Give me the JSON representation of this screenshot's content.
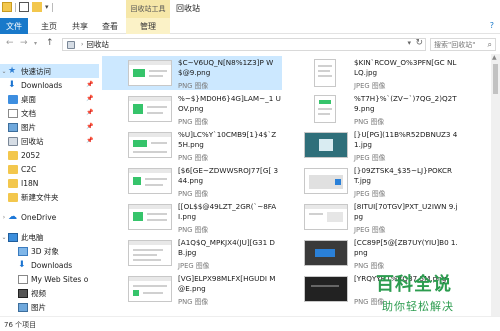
{
  "titlebar": {
    "context_tab": "回收站工具",
    "title": "回收站"
  },
  "ribbon": {
    "tabs": [
      "文件",
      "主页",
      "共享",
      "查看",
      "管理"
    ]
  },
  "address": {
    "location": "回收站",
    "search_placeholder": "搜索\"回收站\""
  },
  "sidebar": {
    "items": [
      {
        "label": "快速访问",
        "icon": "star-icon"
      },
      {
        "label": "Downloads",
        "icon": "download-icon",
        "pinned": true
      },
      {
        "label": "桌面",
        "icon": "desktop-folder-icon",
        "pinned": true
      },
      {
        "label": "文档",
        "icon": "documents-folder-icon",
        "pinned": true
      },
      {
        "label": "图片",
        "icon": "pictures-folder-icon",
        "pinned": true
      },
      {
        "label": "回收站",
        "icon": "recycle-bin-icon",
        "pinned": true
      },
      {
        "label": "2052",
        "icon": "folder-icon"
      },
      {
        "label": "C2C",
        "icon": "folder-icon"
      },
      {
        "label": "I18N",
        "icon": "folder-icon"
      },
      {
        "label": "新建文件夹",
        "icon": "folder-icon"
      },
      {
        "label": "OneDrive",
        "icon": "cloud-icon"
      },
      {
        "label": "此电脑",
        "icon": "computer-icon"
      },
      {
        "label": "3D 对象",
        "icon": "3d-objects-icon"
      },
      {
        "label": "Downloads",
        "icon": "download-icon"
      },
      {
        "label": "My Web Sites o",
        "icon": "web-folder-icon"
      },
      {
        "label": "视频",
        "icon": "video-folder-icon"
      },
      {
        "label": "图片",
        "icon": "pictures-folder-icon"
      }
    ]
  },
  "files": [
    {
      "name": "$C~V6UQ_N[N8%1Z3]P W$@9.png",
      "type": "PNG 图像"
    },
    {
      "name": "$KIN`RCOW_O%3PFN[GC NLLQ.jpg",
      "type": "JPEG 图像"
    },
    {
      "name": "%~$}MD0H6}4G]LAM~_1 UOV.png",
      "type": "PNG 图像"
    },
    {
      "name": "%T7H}%`(ZV~`)7QG_2)Q2T 9.png",
      "type": "PNG 图像"
    },
    {
      "name": "%U]LC%Y`10CMB9[1}4$`Z 5H.png",
      "type": "PNG 图像"
    },
    {
      "name": "[}U[PG](11B%R52DBNUZ3 41.jpg",
      "type": "JPEG 图像"
    },
    {
      "name": "[$6[GE~ZDWWSROJ77[G[ 344.png",
      "type": "PNG 图像"
    },
    {
      "name": "[}09ZTSK4_$35~LJ}POKCR T.jpg",
      "type": "JPEG 图像"
    },
    {
      "name": "[[OL$$@49LZT_2GR(`~8FA I.png",
      "type": "PNG 图像"
    },
    {
      "name": "[8ITUI[70TGV]PXT_U2IWN 9.jpg",
      "type": "JPEG 图像"
    },
    {
      "name": "[A1Q$Q_MPKJX4(JU][G31 DB.jpg",
      "type": "JPEG 图像"
    },
    {
      "name": "[CC89P[5@[ZB7UY(YIU]B0 1.png",
      "type": "PNG 图像"
    },
    {
      "name": "[VG]ELPX98MLFX[HGUDI M@E.png",
      "type": "PNG 图像"
    },
    {
      "name": "[YRQYYH1%RQ37 5M.png",
      "type": "PNG 图像"
    }
  ],
  "status": {
    "item_count": "76 个项目"
  },
  "watermark": {
    "title": "百科全说",
    "subtitle": "助你轻松解决"
  }
}
